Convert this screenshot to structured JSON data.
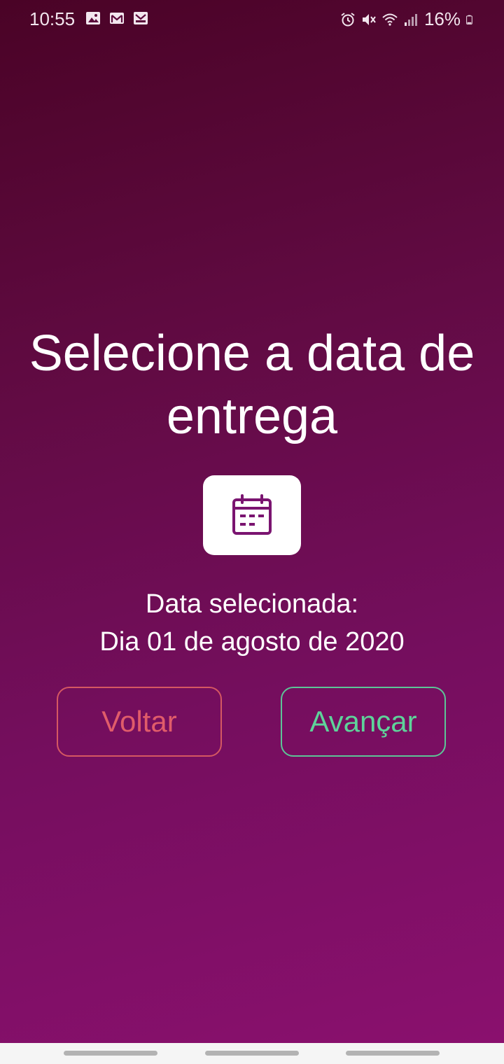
{
  "status_bar": {
    "time": "10:55",
    "battery": "16%",
    "left_icons": [
      "image-icon",
      "gmail-icon",
      "gmail-icon"
    ],
    "right_icons": [
      "alarm-icon",
      "mute-icon",
      "wifi-icon",
      "signal-icon",
      "battery-icon"
    ]
  },
  "main": {
    "title_line1": "Selecione a data de",
    "title_line2": "entrega",
    "calendar_icon": "calendar-icon",
    "selected_label": "Data selecionada:",
    "selected_date": "Dia 01 de agosto de 2020",
    "back_label": "Voltar",
    "next_label": "Avançar"
  },
  "colors": {
    "background_top": "#4a0326",
    "background_bottom": "#8a106e",
    "back_button": "#e05c6a",
    "next_button": "#5ed39a",
    "calendar_icon": "#7a1470"
  }
}
